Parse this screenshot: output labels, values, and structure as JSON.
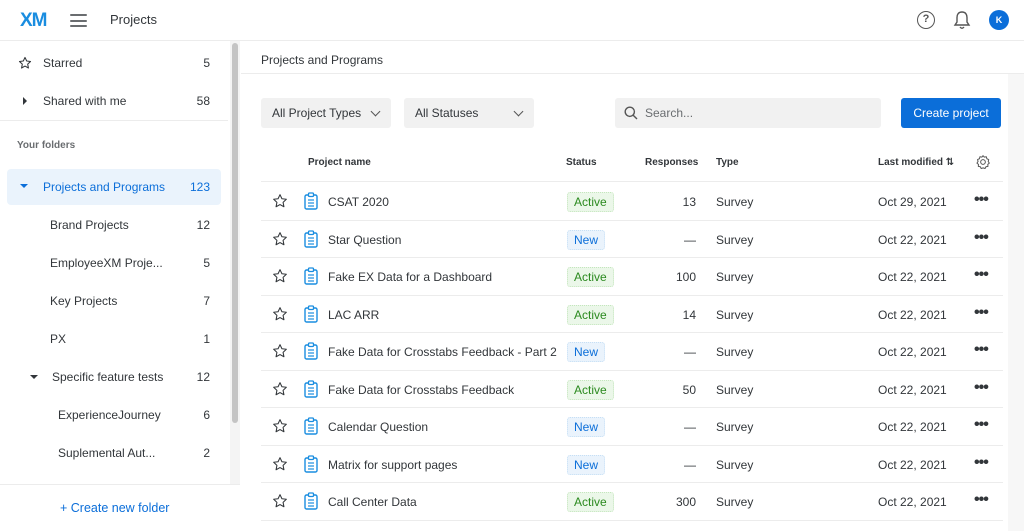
{
  "header": {
    "logo": "XM",
    "title": "Projects",
    "avatar_initial": "K",
    "help_glyph": "?"
  },
  "sidebar": {
    "top_items": [
      {
        "label": "Starred",
        "count": "5",
        "icon": "star-icon"
      },
      {
        "label": "Shared with me",
        "count": "58",
        "icon": "caret-right-icon"
      }
    ],
    "section_label": "Your folders",
    "folders": [
      {
        "label": "Projects and Programs",
        "count": "123",
        "selected": true,
        "expanded": true
      },
      {
        "label": "Brand Projects",
        "count": "12"
      },
      {
        "label": "EmployeeXM Proje...",
        "count": "5"
      },
      {
        "label": "Key Projects",
        "count": "7"
      },
      {
        "label": "PX",
        "count": "1"
      },
      {
        "label": "Specific feature tests",
        "count": "12",
        "expanded": true
      },
      {
        "label": "ExperienceJourney",
        "count": "6"
      },
      {
        "label": "Suplemental Aut...",
        "count": "2"
      }
    ],
    "create_folder": "+ Create new folder"
  },
  "main": {
    "title": "Projects and Programs",
    "filters": {
      "project_type": "All Project Types",
      "status": "All Statuses"
    },
    "search_placeholder": "Search...",
    "create_button": "Create project",
    "columns": {
      "name": "Project name",
      "status": "Status",
      "responses": "Responses",
      "type": "Type",
      "last_modified": "Last modified ⇅"
    },
    "rows": [
      {
        "name": "CSAT 2020",
        "status": "Active",
        "responses": "13",
        "type": "Survey",
        "modified": "Oct 29, 2021"
      },
      {
        "name": "Star Question",
        "status": "New",
        "responses": "—",
        "type": "Survey",
        "modified": "Oct 22, 2021"
      },
      {
        "name": "Fake EX Data for a Dashboard",
        "status": "Active",
        "responses": "100",
        "type": "Survey",
        "modified": "Oct 22, 2021"
      },
      {
        "name": "LAC ARR",
        "status": "Active",
        "responses": "14",
        "type": "Survey",
        "modified": "Oct 22, 2021"
      },
      {
        "name": "Fake Data for Crosstabs Feedback - Part 2",
        "status": "New",
        "responses": "—",
        "type": "Survey",
        "modified": "Oct 22, 2021"
      },
      {
        "name": "Fake Data for Crosstabs Feedback",
        "status": "Active",
        "responses": "50",
        "type": "Survey",
        "modified": "Oct 22, 2021"
      },
      {
        "name": "Calendar Question",
        "status": "New",
        "responses": "—",
        "type": "Survey",
        "modified": "Oct 22, 2021"
      },
      {
        "name": "Matrix for support pages",
        "status": "New",
        "responses": "—",
        "type": "Survey",
        "modified": "Oct 22, 2021"
      },
      {
        "name": "Call Center Data",
        "status": "Active",
        "responses": "300",
        "type": "Survey",
        "modified": "Oct 22, 2021"
      }
    ],
    "more_glyph": "•••"
  },
  "colors": {
    "brand": "#0b6ed9",
    "active_text": "#2b8a1f",
    "active_bg": "#ebf7e9",
    "new_bg": "#eaf3fc"
  }
}
